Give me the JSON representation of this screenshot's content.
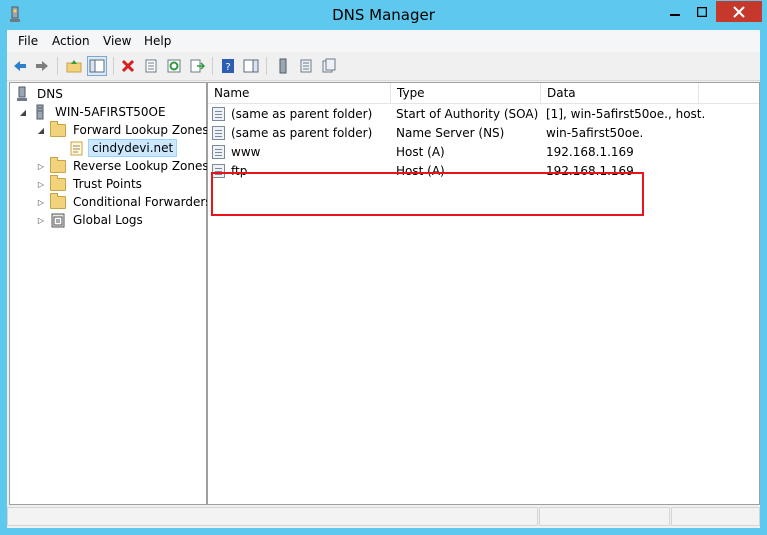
{
  "window": {
    "title": "DNS Manager",
    "close_color": "#c7382c",
    "frame_color": "#5ec8ee"
  },
  "menu": [
    "File",
    "Action",
    "View",
    "Help"
  ],
  "toolbar": {
    "buttons": [
      "back-icon",
      "forward-icon",
      "up-folder-icon",
      "show-hide-tree-icon",
      "delete-icon",
      "properties-icon",
      "refresh-icon",
      "export-list-icon",
      "help-icon",
      "show-hide-action-pane-icon",
      "new-host-icon",
      "new-record-icon",
      "new-other-records-icon"
    ]
  },
  "tree": {
    "root": "DNS",
    "server": "WIN-5AFIRST50OE",
    "forward": "Forward Lookup Zones",
    "zone": "cindydevi.net",
    "reverse": "Reverse Lookup Zones",
    "trust": "Trust Points",
    "conditional": "Conditional Forwarders",
    "logs": "Global Logs"
  },
  "list": {
    "columns": [
      "Name",
      "Type",
      "Data"
    ],
    "rows": [
      {
        "name": "(same as parent folder)",
        "type": "Start of Authority (SOA)",
        "data": "[1], win-5afirst50oe., host..."
      },
      {
        "name": "(same as parent folder)",
        "type": "Name Server (NS)",
        "data": "win-5afirst50oe."
      },
      {
        "name": "www",
        "type": "Host (A)",
        "data": "192.168.1.169"
      },
      {
        "name": "ftp",
        "type": "Host (A)",
        "data": "192.168.1.169"
      }
    ],
    "highlight_color": "#e8141c"
  }
}
